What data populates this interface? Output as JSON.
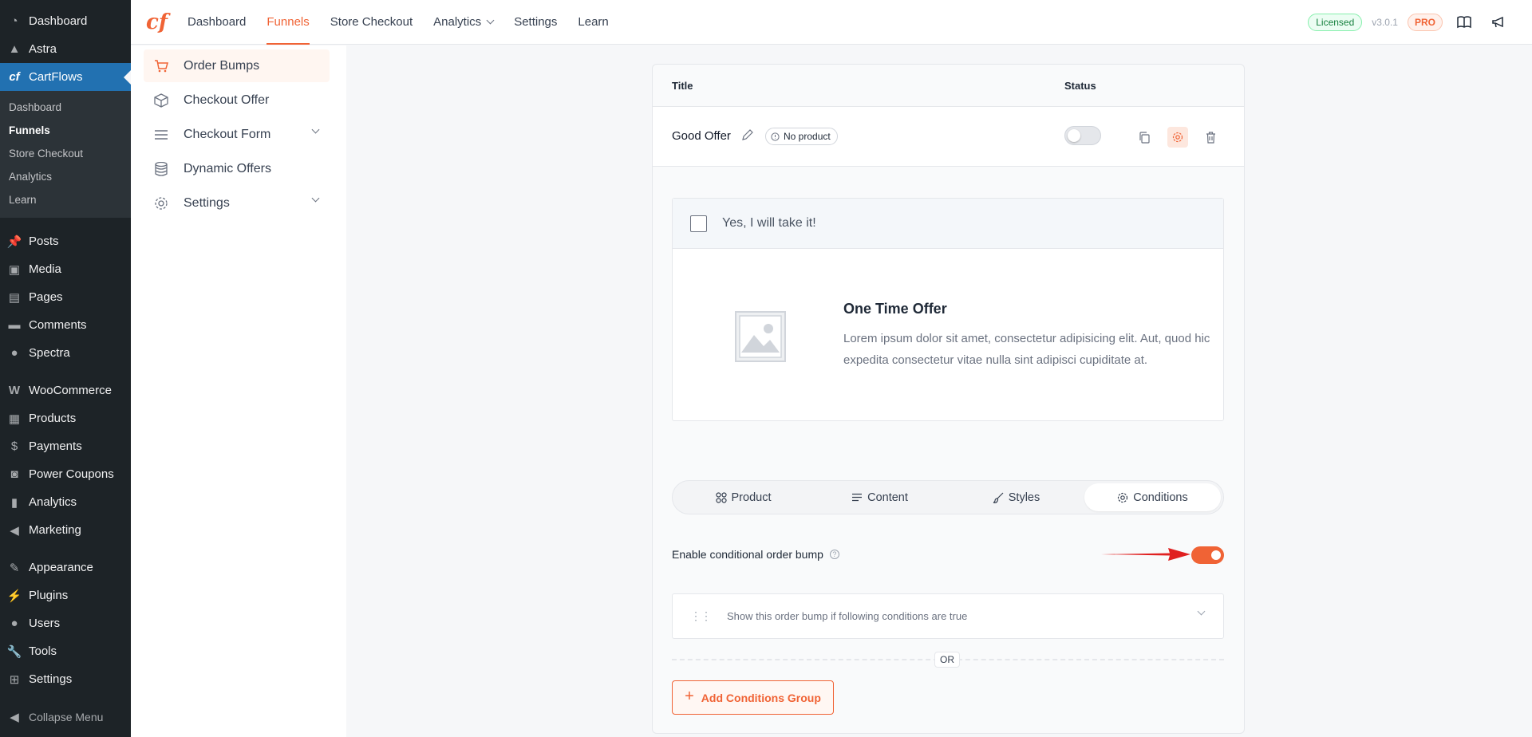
{
  "wp_sidebar": {
    "items_top": [
      {
        "label": "Dashboard",
        "icon": "dashboard-icon"
      },
      {
        "label": "Astra",
        "icon": "astra-icon"
      },
      {
        "label": "CartFlows",
        "icon": "cartflows-icon"
      }
    ],
    "cartflows_sub": [
      {
        "label": "Dashboard"
      },
      {
        "label": "Funnels"
      },
      {
        "label": "Store Checkout"
      },
      {
        "label": "Analytics"
      },
      {
        "label": "Learn"
      }
    ],
    "items_content": [
      {
        "label": "Posts",
        "icon": "pin-icon"
      },
      {
        "label": "Media",
        "icon": "media-icon"
      },
      {
        "label": "Pages",
        "icon": "pages-icon"
      },
      {
        "label": "Comments",
        "icon": "comment-icon"
      },
      {
        "label": "Spectra",
        "icon": "spectra-icon"
      }
    ],
    "items_shop": [
      {
        "label": "WooCommerce",
        "icon": "woocommerce-icon"
      },
      {
        "label": "Products",
        "icon": "products-icon"
      },
      {
        "label": "Payments",
        "icon": "payments-icon"
      },
      {
        "label": "Power Coupons",
        "icon": "coupon-icon"
      },
      {
        "label": "Analytics",
        "icon": "bar-chart-icon"
      },
      {
        "label": "Marketing",
        "icon": "megaphone-icon"
      }
    ],
    "items_admin": [
      {
        "label": "Appearance",
        "icon": "brush-icon"
      },
      {
        "label": "Plugins",
        "icon": "plugin-icon"
      },
      {
        "label": "Users",
        "icon": "user-icon"
      },
      {
        "label": "Tools",
        "icon": "wrench-icon"
      },
      {
        "label": "Settings",
        "icon": "settings-icon"
      }
    ],
    "collapse": "Collapse Menu"
  },
  "topbar": {
    "nav": [
      {
        "label": "Dashboard"
      },
      {
        "label": "Funnels"
      },
      {
        "label": "Store Checkout"
      },
      {
        "label": "Analytics"
      },
      {
        "label": "Settings"
      },
      {
        "label": "Learn"
      }
    ],
    "licensed": "Licensed",
    "version": "v3.0.1",
    "pro": "PRO"
  },
  "subnav": {
    "items": [
      {
        "label": "Order Bumps"
      },
      {
        "label": "Checkout Offer"
      },
      {
        "label": "Checkout Form"
      },
      {
        "label": "Dynamic Offers"
      },
      {
        "label": "Settings"
      }
    ]
  },
  "table": {
    "col_title": "Title",
    "col_status": "Status",
    "row": {
      "title": "Good Offer",
      "product_badge": "No product"
    }
  },
  "preview": {
    "checkbox_label": "Yes, I will take it!",
    "offer_title": "One Time Offer",
    "offer_desc": "Lorem ipsum dolor sit amet, consectetur adipisicing elit. Aut, quod hic expedita consectetur vitae nulla sint adipisci cupiditate at."
  },
  "tabs": [
    {
      "label": "Product"
    },
    {
      "label": "Content"
    },
    {
      "label": "Styles"
    },
    {
      "label": "Conditions"
    }
  ],
  "conditions": {
    "enable_label": "Enable conditional order bump",
    "enabled": true,
    "group_text": "Show this order bump if following conditions are true",
    "or_label": "OR",
    "add_group": "Add Conditions Group"
  },
  "colors": {
    "accent": "#f06335",
    "wp_sidebar": "#1d2327",
    "wp_active": "#2271b1",
    "annotation_arrow": "#e02020"
  }
}
